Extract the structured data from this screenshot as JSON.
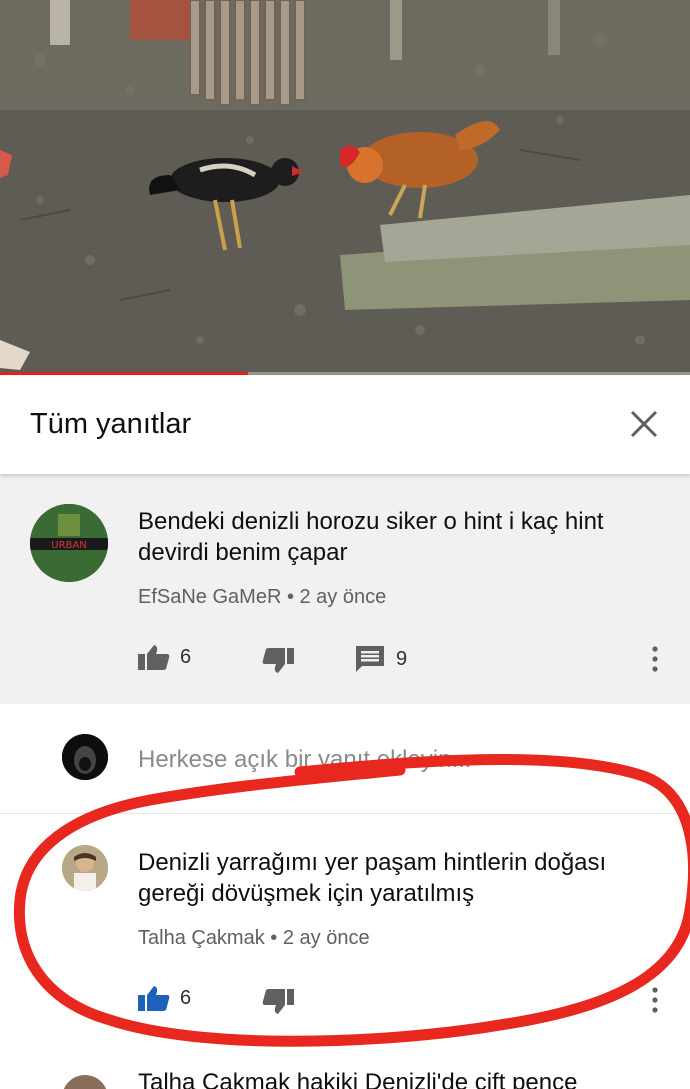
{
  "video": {
    "progress": 0.36,
    "progress_color": "#e62117"
  },
  "header": {
    "title": "Tüm yanıtlar",
    "close_icon": "close-icon"
  },
  "parent_comment": {
    "text": "Bendeki denizli horozu siker o hint i kaç hint devirdi benim çapar",
    "author": "EfSaNe GaMeR",
    "time": "2 ay önce",
    "meta": "EfSaNe GaMeR • 2 ay önce",
    "likes": "6",
    "replies": "9",
    "avatar_text": "URBAN"
  },
  "reply_input": {
    "placeholder": "Herkese açık bir yanıt ekleyin..."
  },
  "reply_comment": {
    "text": "Denizli yarrağımı yer paşam hintlerin doğası gereği dövüşmek için yaratılmış",
    "author": "Talha Çakmak",
    "time": "2 ay önce",
    "meta": "Talha Çakmak • 2 ay önce",
    "likes": "6",
    "liked": true,
    "like_color": "#1c62b9"
  },
  "next_comment_peek": {
    "text": "Talha Çakmak hakiki Denizli'de çift pence"
  },
  "annotation_color": "#e8281e"
}
